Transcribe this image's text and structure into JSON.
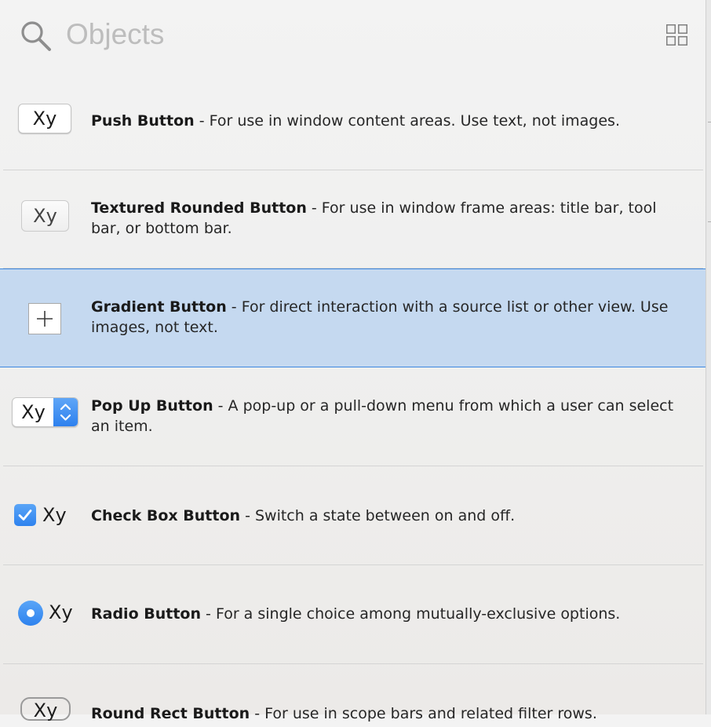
{
  "search": {
    "placeholder": "Objects"
  },
  "colors": {
    "accent": "#2e82ee",
    "selected_row_bg": "#c5d9f0",
    "selected_row_border": "#3b87e0",
    "placeholder_text": "#bdbdbd"
  },
  "icons": {
    "search": "magnifying-glass",
    "view_toggle": "grid-2x2"
  },
  "items": [
    {
      "name": "Push Button",
      "separator": " - ",
      "description": "For use in window content areas. Use text, not images.",
      "preview_label": "Xy",
      "selected": false
    },
    {
      "name": "Textured Rounded Button",
      "separator": " - ",
      "description": "For use in window frame areas: title bar, tool bar, or bottom bar.",
      "preview_label": "Xy",
      "selected": false
    },
    {
      "name": "Gradient Button",
      "separator": " - ",
      "description": "For direct interaction with a source list or other view. Use images, not text.",
      "preview_label": "",
      "selected": true
    },
    {
      "name": "Pop Up Button",
      "separator": " - ",
      "description": "A pop-up or a pull-down menu from which a user can select an item.",
      "preview_label": "Xy",
      "selected": false
    },
    {
      "name": "Check Box Button",
      "separator": " - ",
      "description": "Switch a state between on and off.",
      "preview_label": "Xy",
      "checked": true,
      "selected": false
    },
    {
      "name": "Radio Button",
      "separator": " - ",
      "description": "For a single choice among mutually-exclusive options.",
      "preview_label": "Xy",
      "checked": true,
      "selected": false
    },
    {
      "name": "Round Rect Button",
      "separator": " - ",
      "description": "For use in scope bars and related filter rows.",
      "preview_label": "Xy",
      "selected": false
    }
  ]
}
